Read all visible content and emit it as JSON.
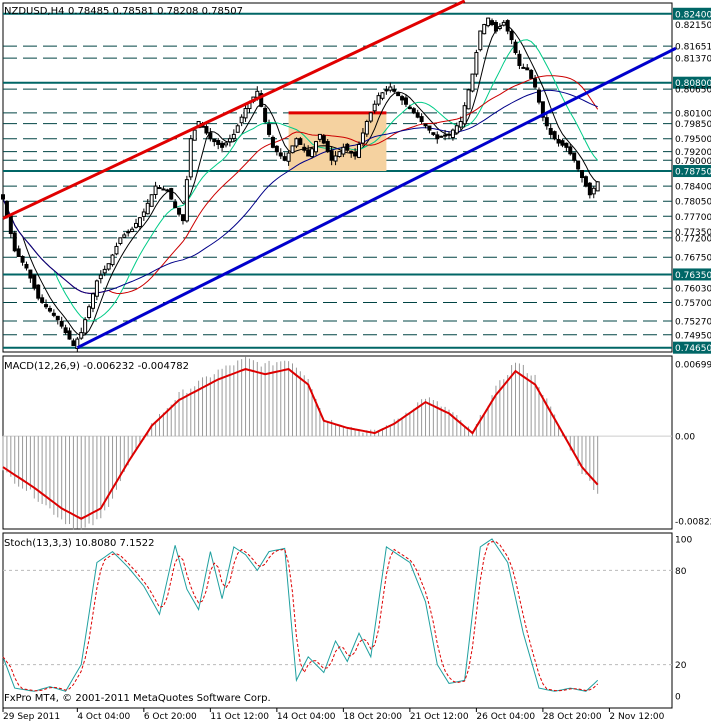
{
  "header": {
    "symbol": "NZDUSD,H4",
    "ohlc": "0.78485 0.78581 0.78208 0.78507"
  },
  "price_axis_labels": [
    "0.82400",
    "0.82150",
    "0.81651",
    "0.81370",
    "0.80800",
    "0.80650",
    "0.80100",
    "0.79850",
    "0.79500",
    "0.79200",
    "0.79000",
    "0.78750",
    "0.78400",
    "0.78050",
    "0.77700",
    "0.77350",
    "0.77200",
    "0.76750",
    "0.76350",
    "0.76030",
    "0.75700",
    "0.75270",
    "0.74950",
    "0.74650"
  ],
  "price_axis_highlight": [
    "0.82400",
    "0.80800",
    "0.78750",
    "0.76350",
    "0.74650"
  ],
  "macd": {
    "label": "MACD(12,26,9) -0.006232 -0.004782",
    "axis_top": "0.00699",
    "axis_zero": "0.00",
    "axis_bottom": "-0.00822"
  },
  "stoch": {
    "label": "Stoch(13,3,3) 10.8080 7.1522",
    "axis_labels": [
      "100",
      "80",
      "20",
      "0"
    ]
  },
  "time_axis_labels": [
    "29 Sep 2011",
    "4 Oct 04:00",
    "6 Oct 20:00",
    "11 Oct 12:00",
    "14 Oct 04:00",
    "18 Oct 20:00",
    "21 Oct 12:00",
    "26 Oct 04:00",
    "28 Oct 20:00",
    "2 Nov 12:00"
  ],
  "footer": "FxPro MT4, © 2001-2011 MetaQuotes Software Corp.",
  "colors": {
    "candles": "#000000",
    "upper_channel": "#e00000",
    "lower_channel": "#0000cc",
    "ma_black": "#000000",
    "ma_green": "#00cc88",
    "ma_red": "#cc0000",
    "ma_navy": "#000088",
    "macd_signal": "#dd0000",
    "macd_hist": "#999999",
    "stoch_main": "#20a0a0",
    "stoch_signal": "#dd0000",
    "level_highlight": "#006666",
    "box_fill": "#f5d2a0"
  },
  "chart_data": {
    "type": "candlestick",
    "symbol": "NZDUSD",
    "timeframe": "H4",
    "y_range": [
      0.7455,
      0.8265
    ],
    "price_levels": [
      0.824,
      0.8165,
      0.8137,
      0.808,
      0.8065,
      0.801,
      0.7985,
      0.795,
      0.792,
      0.79,
      0.7875,
      0.784,
      0.7805,
      0.777,
      0.7735,
      0.772,
      0.7675,
      0.7635,
      0.7603,
      0.757,
      0.7527,
      0.7495,
      0.7465
    ],
    "close_path": [
      {
        "i": 0,
        "c": 0.781
      },
      {
        "i": 3,
        "c": 0.769
      },
      {
        "i": 6,
        "c": 0.765
      },
      {
        "i": 9,
        "c": 0.758
      },
      {
        "i": 11,
        "c": 0.756
      },
      {
        "i": 14,
        "c": 0.753
      },
      {
        "i": 16,
        "c": 0.75
      },
      {
        "i": 18,
        "c": 0.747
      },
      {
        "i": 20,
        "c": 0.75
      },
      {
        "i": 22,
        "c": 0.756
      },
      {
        "i": 24,
        "c": 0.762
      },
      {
        "i": 27,
        "c": 0.766
      },
      {
        "i": 30,
        "c": 0.772
      },
      {
        "i": 33,
        "c": 0.774
      },
      {
        "i": 36,
        "c": 0.778
      },
      {
        "i": 39,
        "c": 0.784
      },
      {
        "i": 42,
        "c": 0.783
      },
      {
        "i": 44,
        "c": 0.779
      },
      {
        "i": 46,
        "c": 0.776
      },
      {
        "i": 48,
        "c": 0.795
      },
      {
        "i": 50,
        "c": 0.799
      },
      {
        "i": 53,
        "c": 0.795
      },
      {
        "i": 56,
        "c": 0.793
      },
      {
        "i": 59,
        "c": 0.796
      },
      {
        "i": 62,
        "c": 0.802
      },
      {
        "i": 65,
        "c": 0.806
      },
      {
        "i": 67,
        "c": 0.799
      },
      {
        "i": 69,
        "c": 0.793
      },
      {
        "i": 72,
        "c": 0.79
      },
      {
        "i": 75,
        "c": 0.795
      },
      {
        "i": 78,
        "c": 0.791
      },
      {
        "i": 81,
        "c": 0.796
      },
      {
        "i": 84,
        "c": 0.79
      },
      {
        "i": 87,
        "c": 0.793
      },
      {
        "i": 90,
        "c": 0.791
      },
      {
        "i": 93,
        "c": 0.799
      },
      {
        "i": 96,
        "c": 0.805
      },
      {
        "i": 99,
        "c": 0.807
      },
      {
        "i": 102,
        "c": 0.804
      },
      {
        "i": 105,
        "c": 0.801
      },
      {
        "i": 108,
        "c": 0.798
      },
      {
        "i": 111,
        "c": 0.795
      },
      {
        "i": 114,
        "c": 0.796
      },
      {
        "i": 117,
        "c": 0.799
      },
      {
        "i": 120,
        "c": 0.81
      },
      {
        "i": 122,
        "c": 0.82
      },
      {
        "i": 124,
        "c": 0.823
      },
      {
        "i": 126,
        "c": 0.82
      },
      {
        "i": 128,
        "c": 0.822
      },
      {
        "i": 130,
        "c": 0.818
      },
      {
        "i": 132,
        "c": 0.812
      },
      {
        "i": 134,
        "c": 0.811
      },
      {
        "i": 136,
        "c": 0.807
      },
      {
        "i": 138,
        "c": 0.8
      },
      {
        "i": 140,
        "c": 0.796
      },
      {
        "i": 142,
        "c": 0.794
      },
      {
        "i": 144,
        "c": 0.793
      },
      {
        "i": 146,
        "c": 0.79
      },
      {
        "i": 148,
        "c": 0.786
      },
      {
        "i": 150,
        "c": 0.782
      },
      {
        "i": 152,
        "c": 0.785
      }
    ],
    "trendlines": [
      {
        "name": "upper_channel",
        "from": {
          "i": 0,
          "c": 0.7765
        },
        "to": {
          "i": 118,
          "c": 0.827
        }
      },
      {
        "name": "lower_channel",
        "from": {
          "i": 19,
          "c": 0.7465
        },
        "to": {
          "i": 172,
          "c": 0.816
        }
      }
    ],
    "consolidation_box": {
      "from_i": 73,
      "to_i": 98,
      "top": 0.801,
      "bottom": 0.7875
    },
    "macd_range": [
      -0.00822,
      0.00699
    ],
    "macd_signal_path": [
      {
        "i": 0,
        "v": -0.003
      },
      {
        "i": 8,
        "v": -0.005
      },
      {
        "i": 15,
        "v": -0.007
      },
      {
        "i": 20,
        "v": -0.008
      },
      {
        "i": 25,
        "v": -0.007
      },
      {
        "i": 32,
        "v": -0.0025
      },
      {
        "i": 38,
        "v": 0.001
      },
      {
        "i": 45,
        "v": 0.0035
      },
      {
        "i": 55,
        "v": 0.0055
      },
      {
        "i": 62,
        "v": 0.0065
      },
      {
        "i": 67,
        "v": 0.006
      },
      {
        "i": 73,
        "v": 0.0065
      },
      {
        "i": 78,
        "v": 0.005
      },
      {
        "i": 82,
        "v": 0.0015
      },
      {
        "i": 88,
        "v": 0.0008
      },
      {
        "i": 95,
        "v": 0.0003
      },
      {
        "i": 100,
        "v": 0.0012
      },
      {
        "i": 108,
        "v": 0.0033
      },
      {
        "i": 114,
        "v": 0.0022
      },
      {
        "i": 120,
        "v": 0.0003
      },
      {
        "i": 126,
        "v": 0.004
      },
      {
        "i": 131,
        "v": 0.0063
      },
      {
        "i": 136,
        "v": 0.005
      },
      {
        "i": 142,
        "v": 0.001
      },
      {
        "i": 148,
        "v": -0.003
      },
      {
        "i": 152,
        "v": -0.0047
      }
    ],
    "stoch_range": [
      0,
      100
    ],
    "stoch_main_path": [
      {
        "i": 0,
        "v": 25
      },
      {
        "i": 3,
        "v": 5
      },
      {
        "i": 8,
        "v": 3
      },
      {
        "i": 12,
        "v": 6
      },
      {
        "i": 16,
        "v": 3
      },
      {
        "i": 20,
        "v": 20
      },
      {
        "i": 24,
        "v": 85
      },
      {
        "i": 28,
        "v": 92
      },
      {
        "i": 32,
        "v": 82
      },
      {
        "i": 36,
        "v": 70
      },
      {
        "i": 40,
        "v": 52
      },
      {
        "i": 44,
        "v": 96
      },
      {
        "i": 47,
        "v": 68
      },
      {
        "i": 50,
        "v": 55
      },
      {
        "i": 53,
        "v": 92
      },
      {
        "i": 56,
        "v": 62
      },
      {
        "i": 59,
        "v": 95
      },
      {
        "i": 62,
        "v": 90
      },
      {
        "i": 65,
        "v": 80
      },
      {
        "i": 68,
        "v": 92
      },
      {
        "i": 72,
        "v": 94
      },
      {
        "i": 75,
        "v": 10
      },
      {
        "i": 78,
        "v": 25
      },
      {
        "i": 82,
        "v": 15
      },
      {
        "i": 85,
        "v": 35
      },
      {
        "i": 88,
        "v": 22
      },
      {
        "i": 91,
        "v": 40
      },
      {
        "i": 94,
        "v": 25
      },
      {
        "i": 98,
        "v": 95
      },
      {
        "i": 101,
        "v": 90
      },
      {
        "i": 104,
        "v": 85
      },
      {
        "i": 108,
        "v": 60
      },
      {
        "i": 111,
        "v": 20
      },
      {
        "i": 114,
        "v": 8
      },
      {
        "i": 118,
        "v": 10
      },
      {
        "i": 122,
        "v": 95
      },
      {
        "i": 125,
        "v": 100
      },
      {
        "i": 129,
        "v": 85
      },
      {
        "i": 133,
        "v": 40
      },
      {
        "i": 137,
        "v": 5
      },
      {
        "i": 141,
        "v": 3
      },
      {
        "i": 145,
        "v": 5
      },
      {
        "i": 149,
        "v": 3
      },
      {
        "i": 152,
        "v": 10
      }
    ]
  }
}
